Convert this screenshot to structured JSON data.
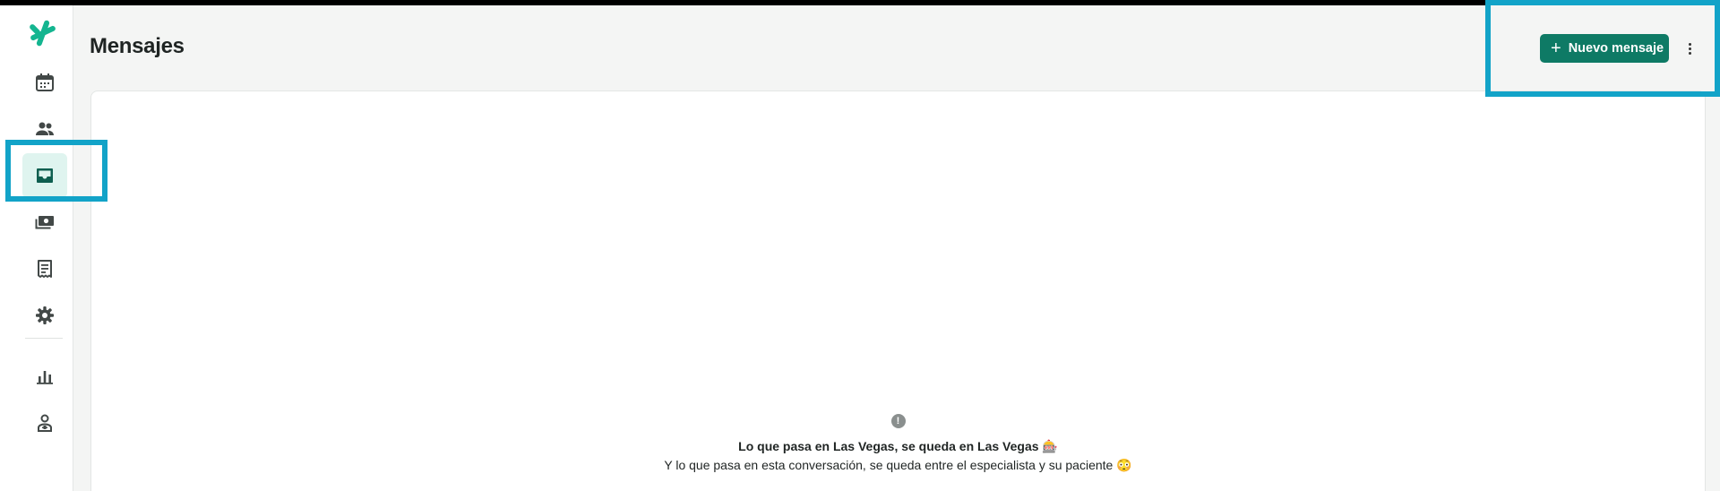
{
  "header": {
    "title": "Mensajes",
    "new_message_label": "Nuevo mensaje",
    "new_message_icon": "+"
  },
  "sidebar": {
    "items": [
      {
        "name": "calendar-icon",
        "active": false
      },
      {
        "name": "patients-icon",
        "active": false
      },
      {
        "name": "inbox-icon",
        "active": true
      },
      {
        "name": "payments-icon",
        "active": false
      },
      {
        "name": "receipt-icon",
        "active": false
      },
      {
        "name": "gear-icon",
        "active": false
      },
      {
        "name": "bar-chart-icon",
        "active": false
      },
      {
        "name": "specialist-icon",
        "active": false
      }
    ]
  },
  "empty_state": {
    "icon": "!",
    "title": "Lo que pasa en Las Vegas, se queda en Las Vegas 🎰",
    "subtitle": "Y lo que pasa en esta conversación, se queda entre el especialista y su paciente 😳"
  },
  "colors": {
    "brand": "#0e7a65",
    "logo": "#14b590",
    "active_bg": "#dff4ef",
    "highlight": "#12a3c8"
  }
}
